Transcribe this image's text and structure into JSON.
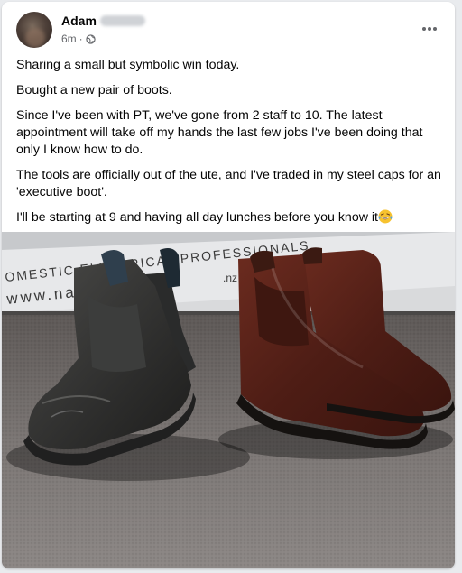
{
  "post": {
    "author": "Adam",
    "time": "6m",
    "dot": "·",
    "more_label": "•••",
    "paragraphs": [
      "Sharing a small but symbolic win today.",
      "Bought a new pair of boots.",
      "Since I've been with PT, we've gone from 2 staff to 10. The latest appointment will take off my hands the last few jobs I've been doing that only I know how to do.",
      "The tools are officially out of the ute, and I've traded in my steel caps for an 'executive boot'."
    ],
    "last_paragraph": "I'll be starting at 9 and having all day lunches before you know it",
    "emoji": "laughing-crying-emoji",
    "visibility_icon": "globe-icon"
  },
  "photo": {
    "banner_line1": "OMESTIC ELECTRICAL PROFESSIONALS",
    "banner_line2": "www.nap",
    "banner_suffix": ".nz"
  }
}
